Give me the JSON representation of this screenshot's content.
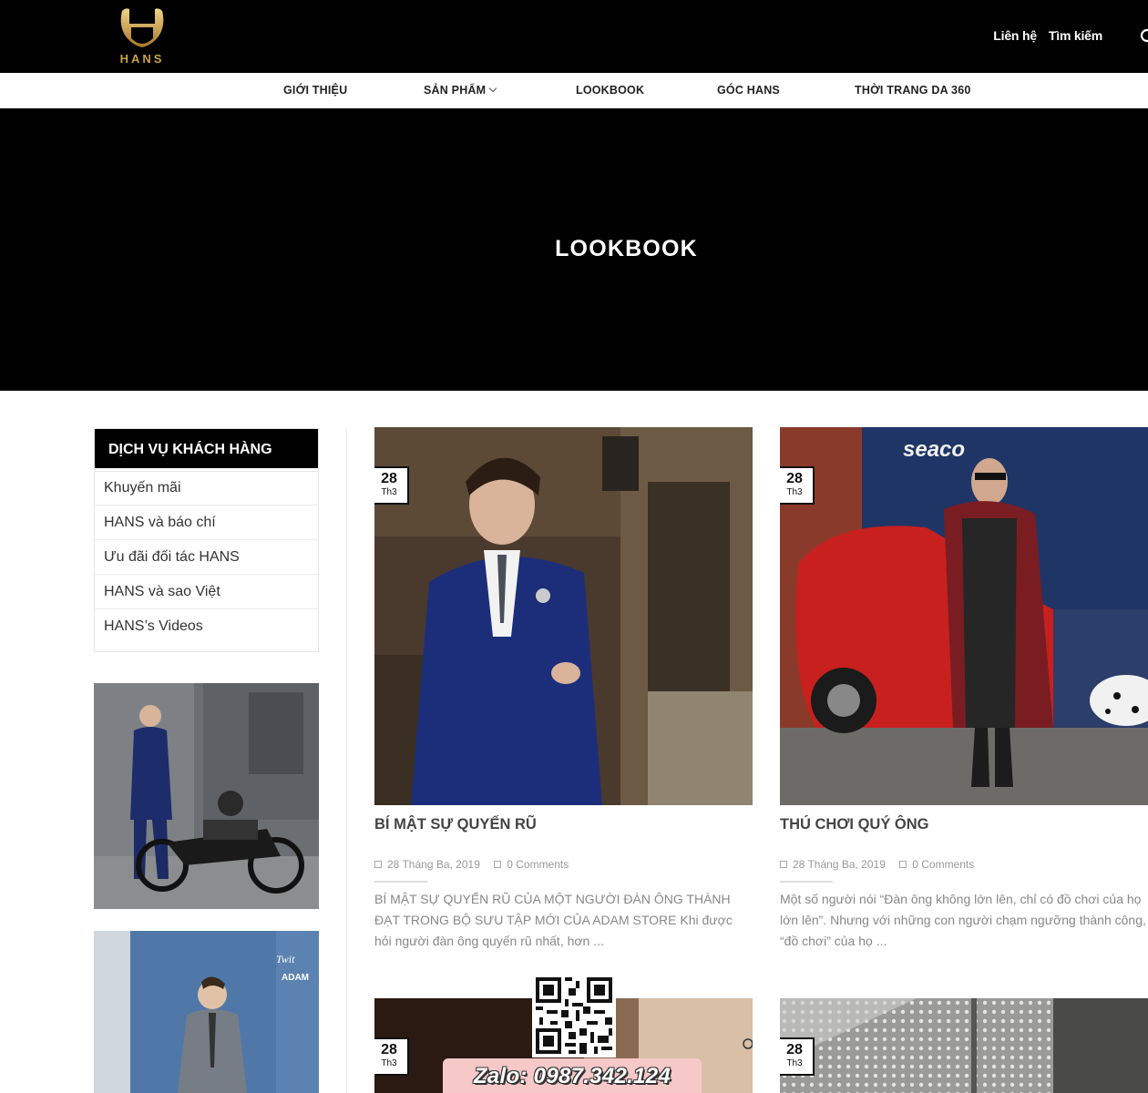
{
  "brand": {
    "logo_text": "HANS",
    "accent": "#c9a14a"
  },
  "top_links": [
    "Liên hệ",
    "Tìm kiếm"
  ],
  "nav": [
    {
      "label": "GIỚI THIỆU",
      "dropdown": false
    },
    {
      "label": "SẢN PHẨM",
      "dropdown": true
    },
    {
      "label": "LOOKBOOK",
      "dropdown": false
    },
    {
      "label": "GÓC HANS",
      "dropdown": false
    },
    {
      "label": "THỜI TRANG DA 360",
      "dropdown": false
    }
  ],
  "hero": {
    "title": "LOOKBOOK"
  },
  "sidebar": {
    "widget_title": "DỊCH VỤ KHÁCH HÀNG",
    "items": [
      "Khuyến mãi",
      "HANS và báo chí",
      "Ưu đãi đối tác HANS",
      "HANS và sao Việt",
      "HANS’s Videos"
    ]
  },
  "posts": [
    {
      "day": "28",
      "month": "Th3",
      "title": "BÍ MẬT SỰ QUYẾN RŨ",
      "date": "28 Tháng Ba, 2019",
      "comments": "0 Comments",
      "excerpt": "BÍ MẬT SỰ QUYẾN RŨ CỦA MỘT NGƯỜI ĐÀN ÔNG THÀNH ĐẠT TRONG BỘ SƯU TẬP MỚI CỦA ADAM STORE Khi được hỏi người đàn ông quyến rũ nhất, hơn ..."
    },
    {
      "day": "28",
      "month": "Th3",
      "title": "THÚ CHƠI QUÝ ÔNG",
      "date": "28 Tháng Ba, 2019",
      "comments": "0 Comments",
      "excerpt_lines": [
        "Một số người nói “Đàn ông không lớn lên, chỉ có đồ chơi của họ",
        "lớn lên”. Nhưng với những con người chạm ngưỡng thành công,",
        "“đồ chơi” của họ ..."
      ]
    },
    {
      "day": "28",
      "month": "Th3"
    },
    {
      "day": "28",
      "month": "Th3"
    }
  ],
  "floating": {
    "zalo_text": "Zalo: 0987.342.124"
  }
}
